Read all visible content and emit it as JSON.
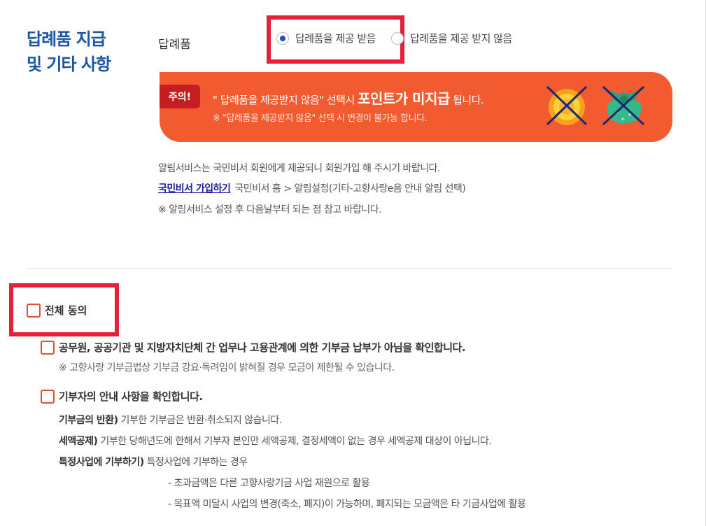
{
  "section": {
    "title_line1": "답례품 지급",
    "title_line2": "및 기타 사항"
  },
  "gift": {
    "label": "답례품",
    "option_receive": "답례품을 제공 받음",
    "option_decline": "답례품을 제공 받지 않음",
    "selected": "receive"
  },
  "banner": {
    "badge": "주의!",
    "line1_prefix": "\" 답례품을 제공받지 않음\" 선택시",
    "line1_emphasis": "포인트가 미지급",
    "line1_suffix": "됩니다.",
    "line2": "※ \"답례품을 제공받지 않음\" 선택 시 변경이 불가능 합니다.",
    "icons": [
      "coin-crossed-icon",
      "gift-bundle-crossed-icon"
    ]
  },
  "notice": {
    "line1": "알림서비스는 국민비서 회원에게 제공되니 회원가입 해 주시기 바랍니다.",
    "link": "국민비서 가입하기",
    "line2_rest": "국민비서 홈 > 알림설정(기타-고향사랑e음 안내 알림 선택)",
    "line3": "※ 알림서비스 설정 후 다음날부터 되는 점 참고 바랍니다."
  },
  "agreements": {
    "all_label": "전체 동의",
    "item1": {
      "label": "공무원, 공공기관 및 지방자치단체 간 업무나 고용관계에 의한 기부금 납부가 아님을 확인합니다.",
      "note": "※ 고향사랑 기부금법상 기부금 강요·독려임이 밝혀질 경우 모금이 제한될 수 있습니다."
    },
    "item2": {
      "label": "기부자의 안내 사항을 확인합니다.",
      "refund_title": "기부금의 반환)",
      "refund_text": "기부한 기부금은 반환·취소되지 않습니다.",
      "tax_title": "세액공제)",
      "tax_text": "기부한 당해년도에 한해서 기부자 본인만 세액공제, 결정세액이 없는 경우 세액공제 대상이 아닙니다.",
      "project_title": "특정사업에 기부하기)",
      "project_text": "특정사업에 기부하는 경우",
      "project_sub1": "- 초과금액은 다른 고향사랑기금 사업 재원으로 활용",
      "project_sub2": "- 목표액 미달시 사업의 변경(축소, 폐지)이 가능하며, 폐지되는 모금액은 타 기금사업에 활용"
    }
  },
  "colors": {
    "accent": "#1a55a6",
    "banner": "#f25a2f",
    "highlight": "#e5203a",
    "checkbox": "#e0522e"
  }
}
